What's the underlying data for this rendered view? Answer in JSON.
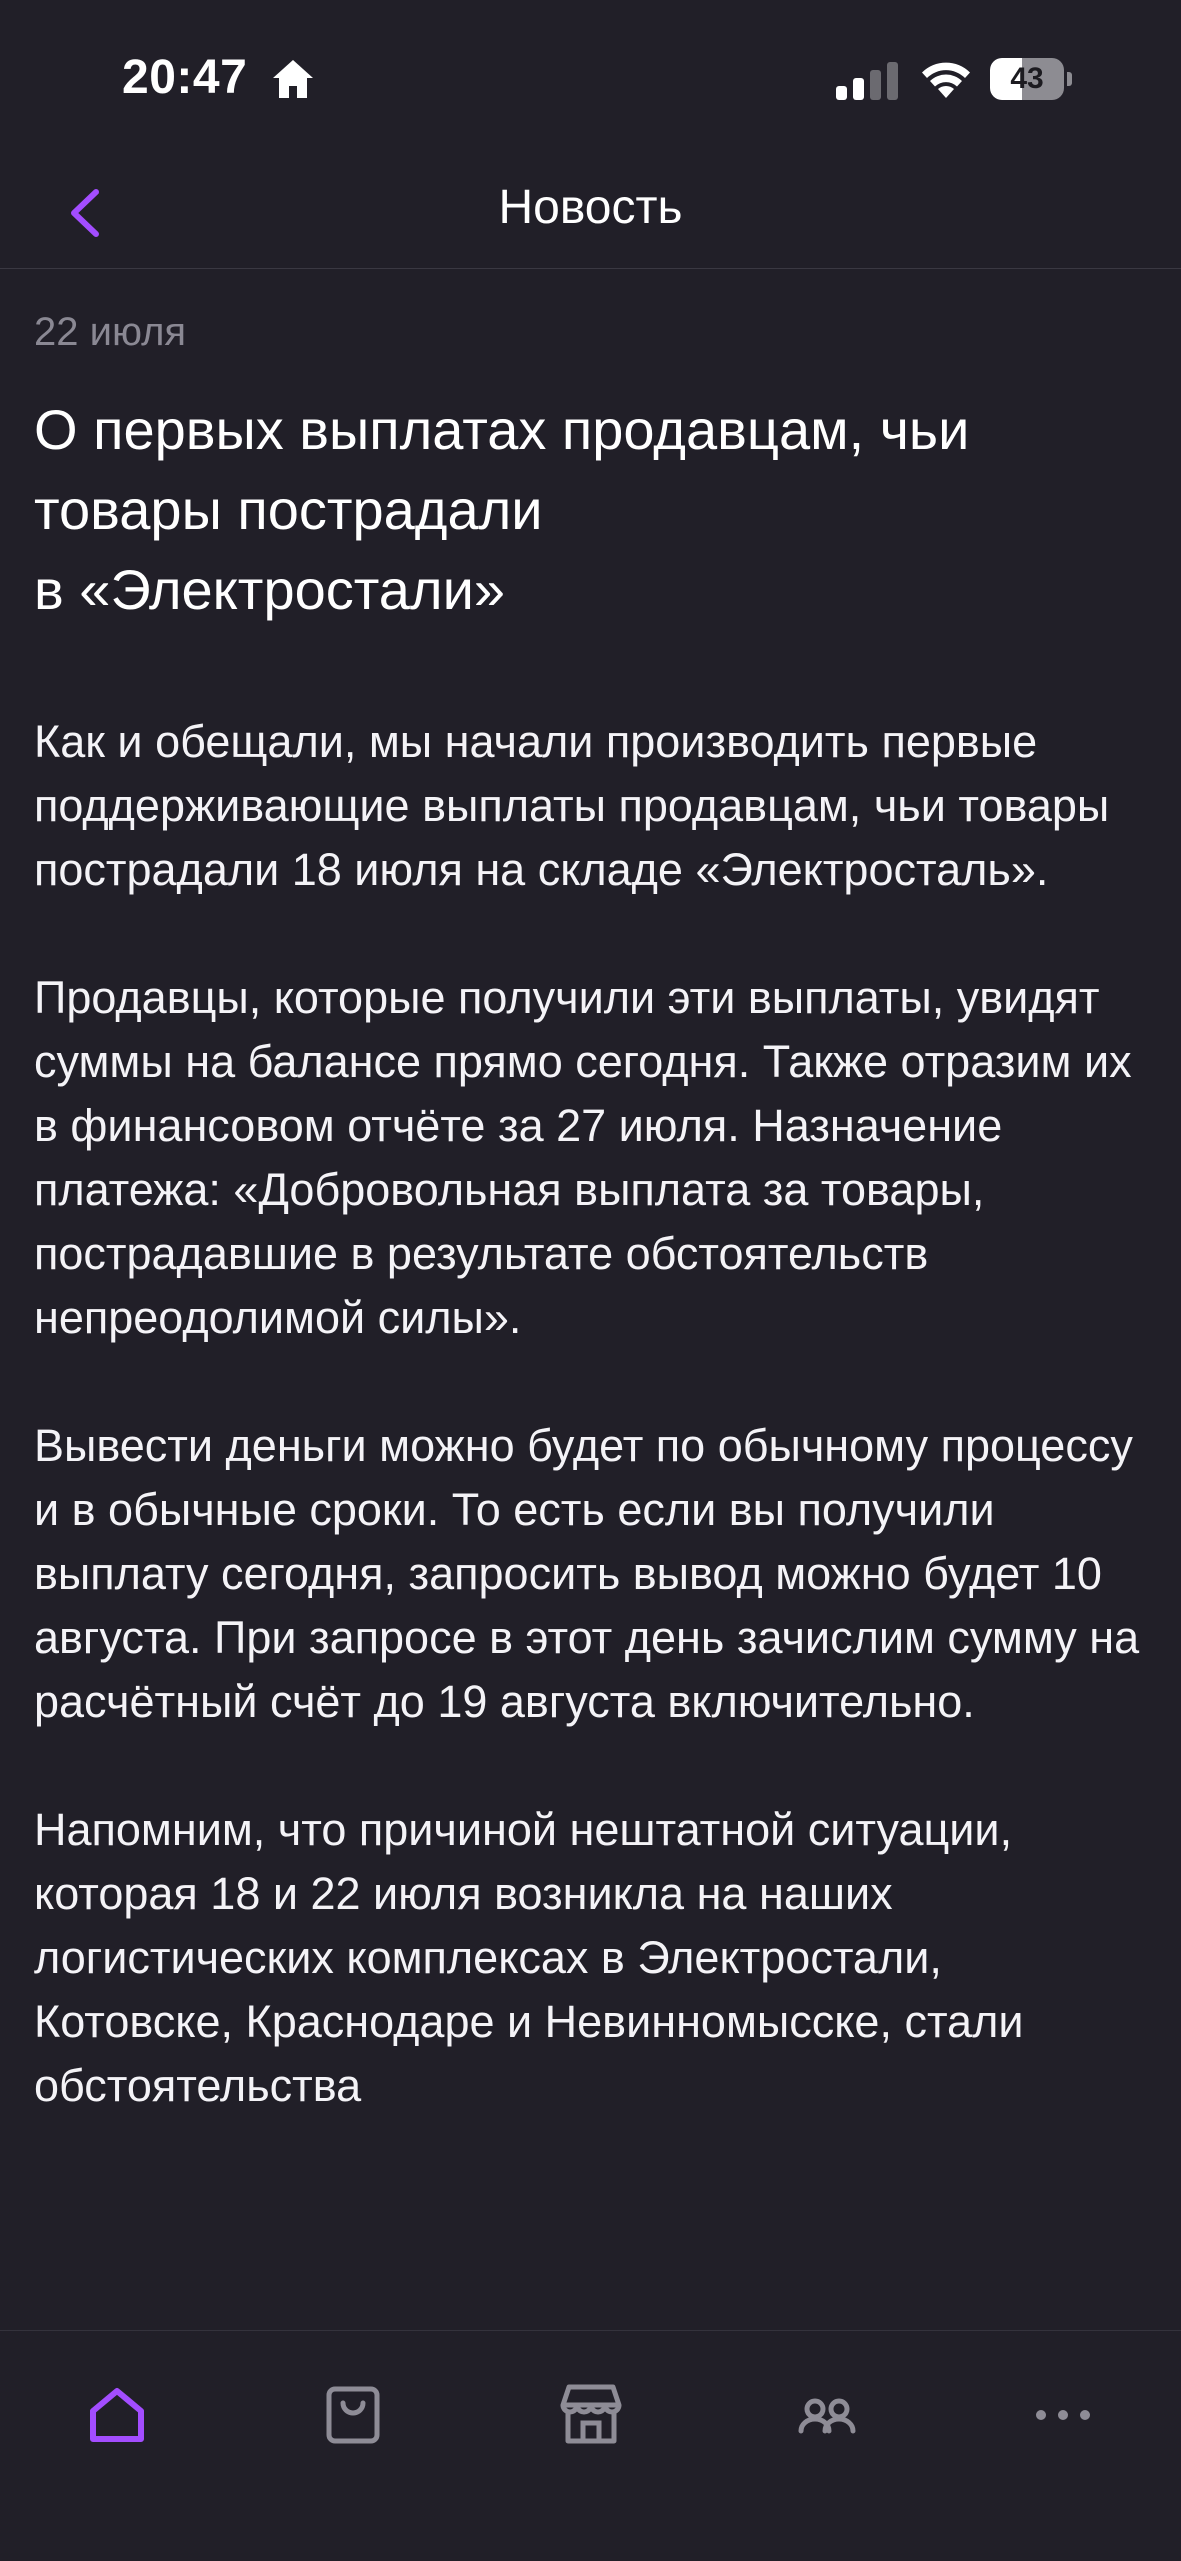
{
  "status_bar": {
    "time": "20:47",
    "battery_level": "43",
    "battery_fraction": 0.43
  },
  "header": {
    "title": "Новость",
    "back_icon": "chevron-left-icon"
  },
  "news": {
    "date": "22 июля",
    "title_lines": [
      "О первых выплатах продавцам, чьи",
      "товары пострадали",
      "в «Электростали»"
    ],
    "paragraphs": [
      "Как и обещали, мы начали производить первые поддерживающие выплаты продавцам, чьи товары пострадали 18 июля на складе «Электросталь».",
      "Продавцы, которые получили эти выплаты, увидят суммы на балансе прямо сегодня. Также отразим их в финансовом отчёте за 27 июля. Назначение платежа: «Добровольная выплата за товары, пострадавшие в результате обстоятельств непреодолимой силы».",
      "Вывести деньги можно будет по обычному процессу и в обычные сроки. То есть если вы получили выплату сегодня, запросить вывод можно будет 10 августа. При запросе в этот день зачислим сумму на расчётный счёт до 19 августа включительно.",
      "Напомним, что причиной нештатной ситуации, которая 18 и 22 июля возникла на наших логистических комплексах в Электростали, Котовске, Краснодаре и Невинномысске, стали обстоятельства"
    ]
  },
  "tab_bar": {
    "tabs": [
      {
        "icon": "home-icon",
        "active": true
      },
      {
        "icon": "shopping-bag-icon",
        "active": false
      },
      {
        "icon": "store-icon",
        "active": false
      },
      {
        "icon": "users-icon",
        "active": false
      },
      {
        "icon": "more-icon",
        "active": false
      }
    ]
  },
  "colors": {
    "background": "#211f28",
    "accent": "#a34dff",
    "text": "#f4f3f7",
    "muted": "#8a8893",
    "inactive_icon": "#8e8c96"
  }
}
